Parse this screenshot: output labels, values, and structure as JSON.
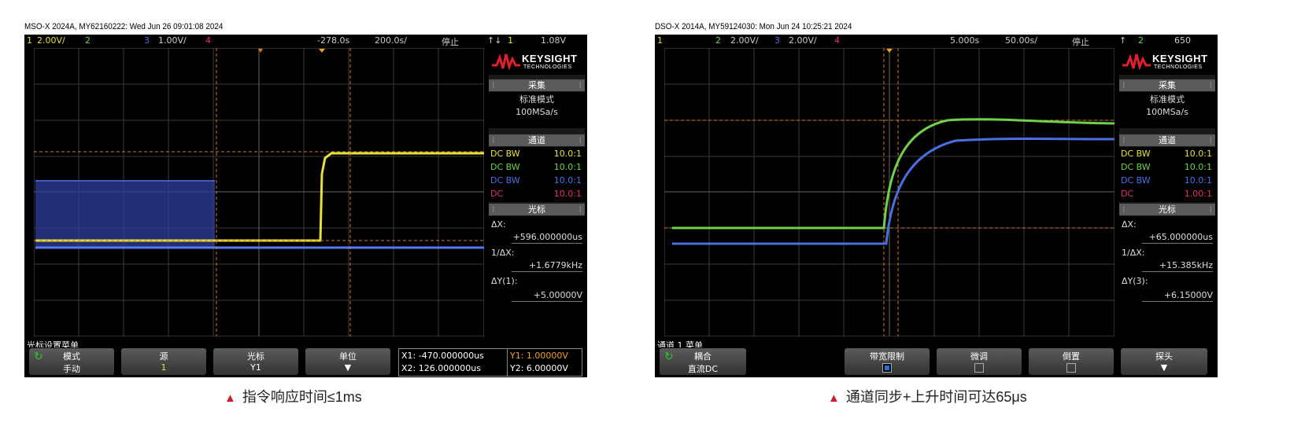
{
  "scopeA": {
    "title": "MSO-X 2024A, MY62160222: Wed Jun 26 09:01:08 2024",
    "topbar": {
      "ch1": "1",
      "ch1_scale": "2.00V/",
      "ch2": "2",
      "ch3": "3",
      "ch3_scale": "1.00V/",
      "ch4": "4",
      "delay": "-278.0s",
      "timebase": "200.0s/",
      "run_state": "停止",
      "trig_mode": "↑↓",
      "trig_ch": "1",
      "trig_level": "1.08V"
    },
    "brand": {
      "name": "KEYSIGHT",
      "sub": "TECHNOLOGIES"
    },
    "acq": {
      "header": "采集",
      "mode": "标准模式",
      "rate": "100MSa/s"
    },
    "channels": {
      "header": "通道",
      "rows": [
        {
          "label": "DC BW",
          "value": "10.0:1",
          "color": "#e8e03a"
        },
        {
          "label": "DC BW",
          "value": "10.0:1",
          "color": "#6fd04a"
        },
        {
          "label": "DC BW",
          "value": "10.0:1",
          "color": "#4a6fe0"
        },
        {
          "label": "DC",
          "value": "10.0:1",
          "color": "#e0306a"
        }
      ]
    },
    "cursors": {
      "header": "光标",
      "dx_label": "ΔX:",
      "dx": "+596.000000us",
      "inv_label": "1/ΔX:",
      "inv": "+1.6779kHz",
      "dy_label": "ΔY(1):",
      "dy": "+5.00000V"
    },
    "menu": {
      "title": "光标设置菜单",
      "keys": [
        {
          "top": "模式",
          "bottom": "手动"
        },
        {
          "top": "源",
          "bottom": "1"
        },
        {
          "top": "光标",
          "bottom": "Y1"
        },
        {
          "top": "单位",
          "bottom": ""
        }
      ],
      "x1": "X1: -470.000000us",
      "x2": "X2: 126.000000us",
      "y1": "Y1: 1.00000V",
      "y2": "Y2: 6.00000V"
    },
    "caption": "指令响应时间≤1ms"
  },
  "scopeB": {
    "title": "DSO-X 2014A, MY59124030: Mon Jun 24 10:25:21 2024",
    "topbar": {
      "ch1": "1",
      "ch2": "2",
      "ch2_scale": "2.00V/",
      "ch3": "3",
      "ch3_scale": "2.00V/",
      "ch4": "4",
      "delay": "5.000s",
      "timebase": "50.00s/",
      "run_state": "停止",
      "trig_mode": "↑",
      "trig_ch": "2",
      "trig_level": "650"
    },
    "brand": {
      "name": "KEYSIGHT",
      "sub": "TECHNOLOGIES"
    },
    "acq": {
      "header": "采集",
      "mode": "标准模式",
      "rate": "100MSa/s"
    },
    "channels": {
      "header": "通道",
      "rows": [
        {
          "label": "DC BW",
          "value": "10.0:1",
          "color": "#e8e03a"
        },
        {
          "label": "DC BW",
          "value": "10.0:1",
          "color": "#6fd04a"
        },
        {
          "label": "DC BW",
          "value": "10.0:1",
          "color": "#4a6fe0"
        },
        {
          "label": "DC",
          "value": "1.00:1",
          "color": "#e0306a"
        }
      ]
    },
    "cursors": {
      "header": "光标",
      "dx_label": "ΔX:",
      "dx": "+65.000000us",
      "inv_label": "1/ΔX:",
      "inv": "+15.385kHz",
      "dy_label": "ΔY(3):",
      "dy": "+6.15000V"
    },
    "menu": {
      "title": "通道 1 菜单",
      "keys": [
        {
          "top": "耦合",
          "bottom": "直流DC"
        },
        {
          "top": "带宽限制",
          "bottom": ""
        },
        {
          "top": "微调",
          "bottom": ""
        },
        {
          "top": "倒置",
          "bottom": ""
        },
        {
          "top": "探头",
          "bottom": ""
        }
      ]
    },
    "caption": "通道同步+上升时间可达65μs"
  },
  "colors": {
    "ch1": "#e8e03a",
    "ch2": "#6fd04a",
    "ch3": "#4a6fe0",
    "ch4": "#e0306a",
    "cursor": "#d07a2a",
    "caption_marker": "#c8202b"
  }
}
